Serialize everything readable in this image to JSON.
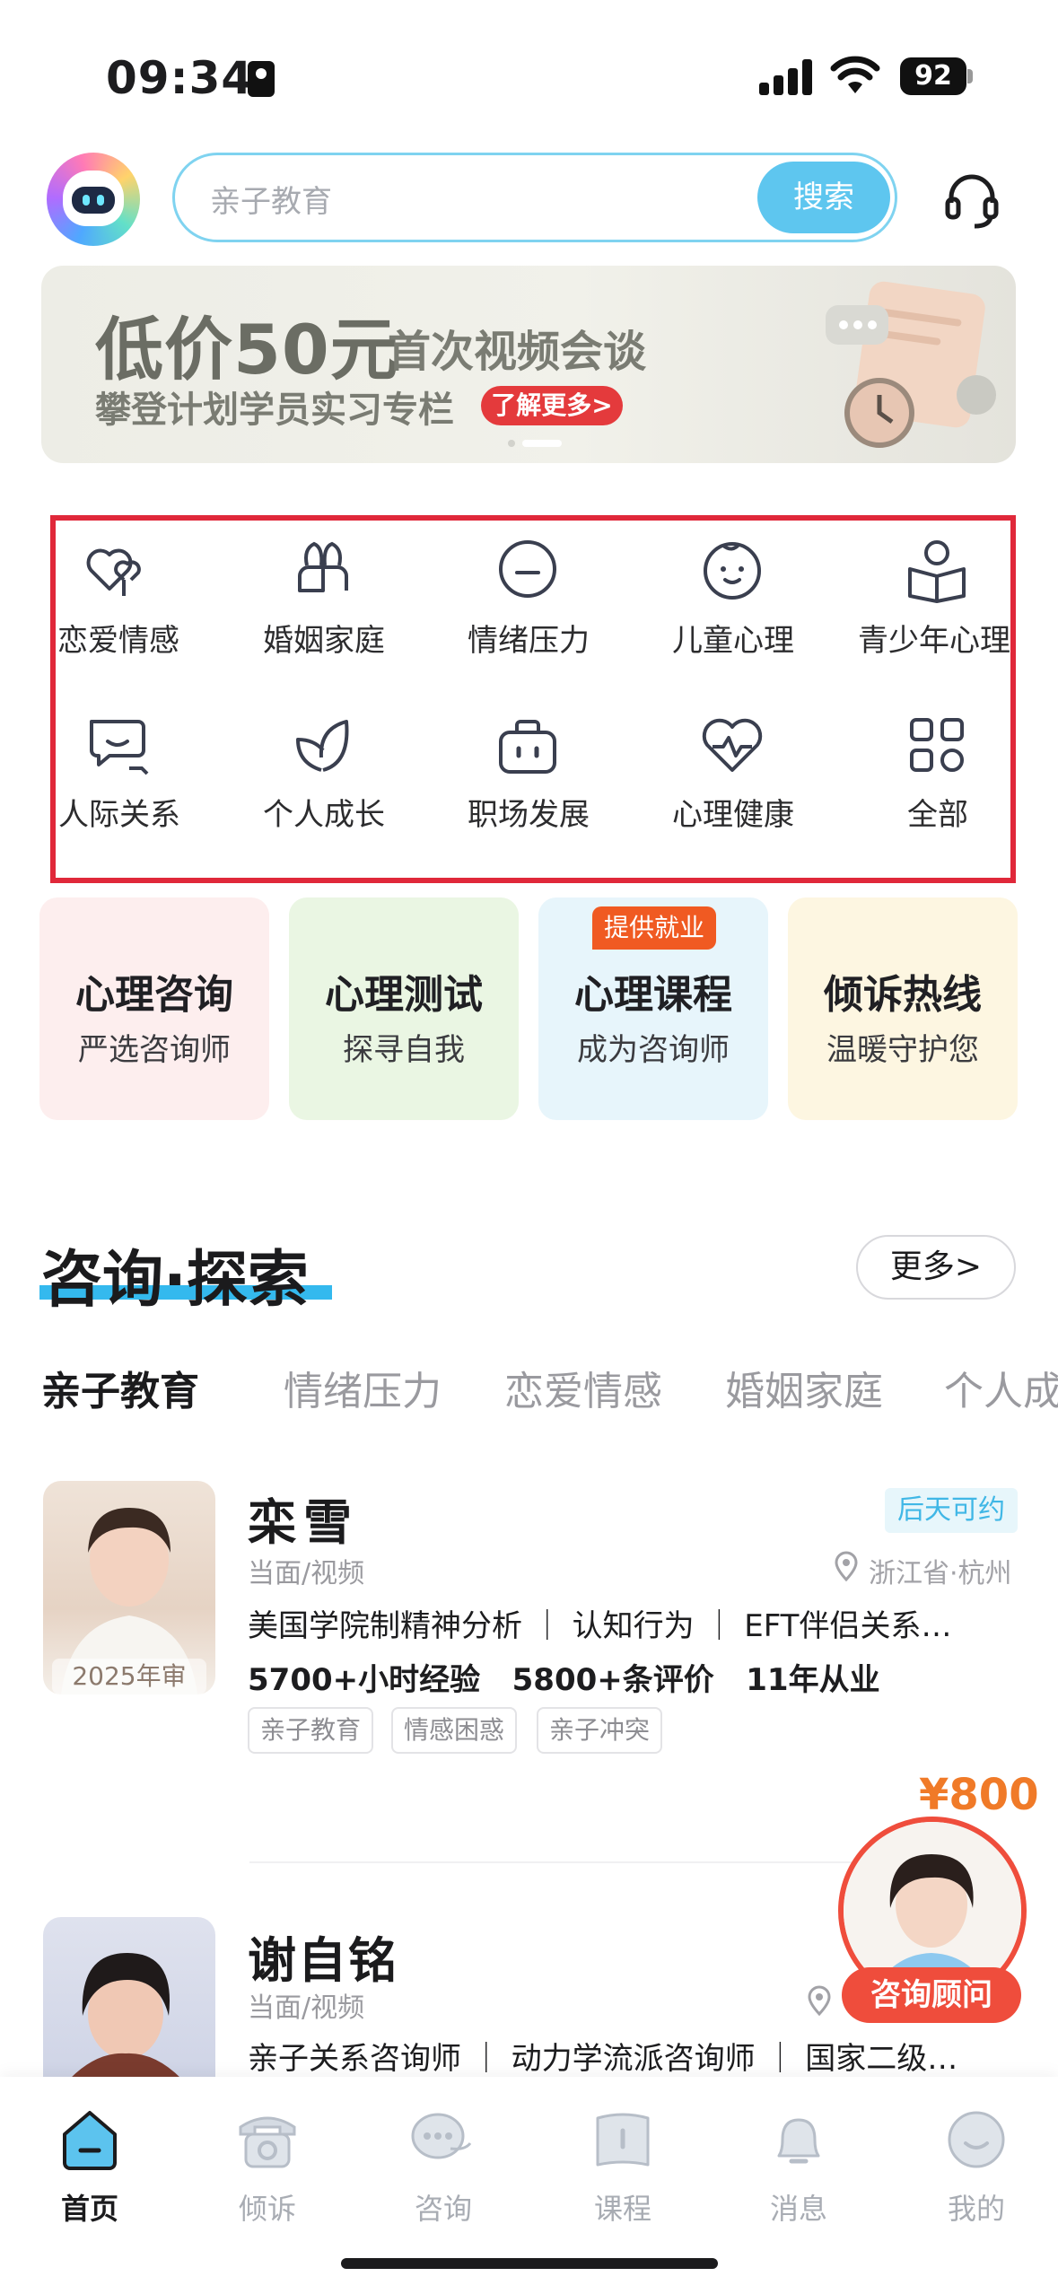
{
  "status_bar": {
    "time": "09:34",
    "battery": "92"
  },
  "header": {
    "search_placeholder": "亲子教育",
    "search_button": "搜索"
  },
  "banner": {
    "title_main": "低价50元",
    "title_rest": "首次视频会谈",
    "subtitle": "攀登计划学员实习专栏",
    "cta": "了解更多>"
  },
  "categories": [
    {
      "label": "恋爱情感",
      "icon": "hearts-icon"
    },
    {
      "label": "婚姻家庭",
      "icon": "couple-icon"
    },
    {
      "label": "情绪压力",
      "icon": "sad-face-icon"
    },
    {
      "label": "儿童心理",
      "icon": "child-face-icon"
    },
    {
      "label": "青少年心理",
      "icon": "reading-teen-icon"
    },
    {
      "label": "人际关系",
      "icon": "chat-bubbles-icon"
    },
    {
      "label": "个人成长",
      "icon": "leaf-icon"
    },
    {
      "label": "职场发展",
      "icon": "briefcase-icon"
    },
    {
      "label": "心理健康",
      "icon": "heartbeat-icon"
    },
    {
      "label": "全部",
      "icon": "grid-icon"
    }
  ],
  "services": [
    {
      "title": "心理咨询",
      "subtitle": "严选咨询师",
      "bg": "#fdeeee"
    },
    {
      "title": "心理测试",
      "subtitle": "探寻自我",
      "bg": "#eaf6e3"
    },
    {
      "title": "心理课程",
      "subtitle": "成为咨询师",
      "bg": "#e7f5fb",
      "tag": "提供就业"
    },
    {
      "title": "倾诉热线",
      "subtitle": "温暖守护您",
      "bg": "#fdf6e1"
    }
  ],
  "section": {
    "title": "咨询·探索",
    "more": "更多>",
    "tabs": [
      "亲子教育",
      "情绪压力",
      "恋爱情感",
      "婚姻家庭",
      "个人成长"
    ]
  },
  "counselors": [
    {
      "name": "栾雪",
      "badge": "2025年审",
      "mode": "当面/视频",
      "availability": "后天可约",
      "location": "浙江省·杭州",
      "specialties": "美国学院制精神分析 ｜ 认知行为 ｜ EFT伴侣关系…",
      "stats": "5700+小时经验   5800+条评价   11年从业",
      "tags": [
        "亲子教育",
        "情感困惑",
        "亲子冲突"
      ],
      "price": "¥800"
    },
    {
      "name": "谢自铭",
      "mode": "当面/视频",
      "specialties": "亲子关系咨询师 ｜ 动力学流派咨询师 ｜ 国家二级…"
    }
  ],
  "floating": {
    "label": "咨询顾问"
  },
  "bottom_nav": [
    {
      "label": "首页",
      "icon": "home-icon",
      "active": true
    },
    {
      "label": "倾诉",
      "icon": "phone-icon"
    },
    {
      "label": "咨询",
      "icon": "chat-icon"
    },
    {
      "label": "课程",
      "icon": "book-icon"
    },
    {
      "label": "消息",
      "icon": "bell-icon"
    },
    {
      "label": "我的",
      "icon": "profile-icon"
    }
  ]
}
